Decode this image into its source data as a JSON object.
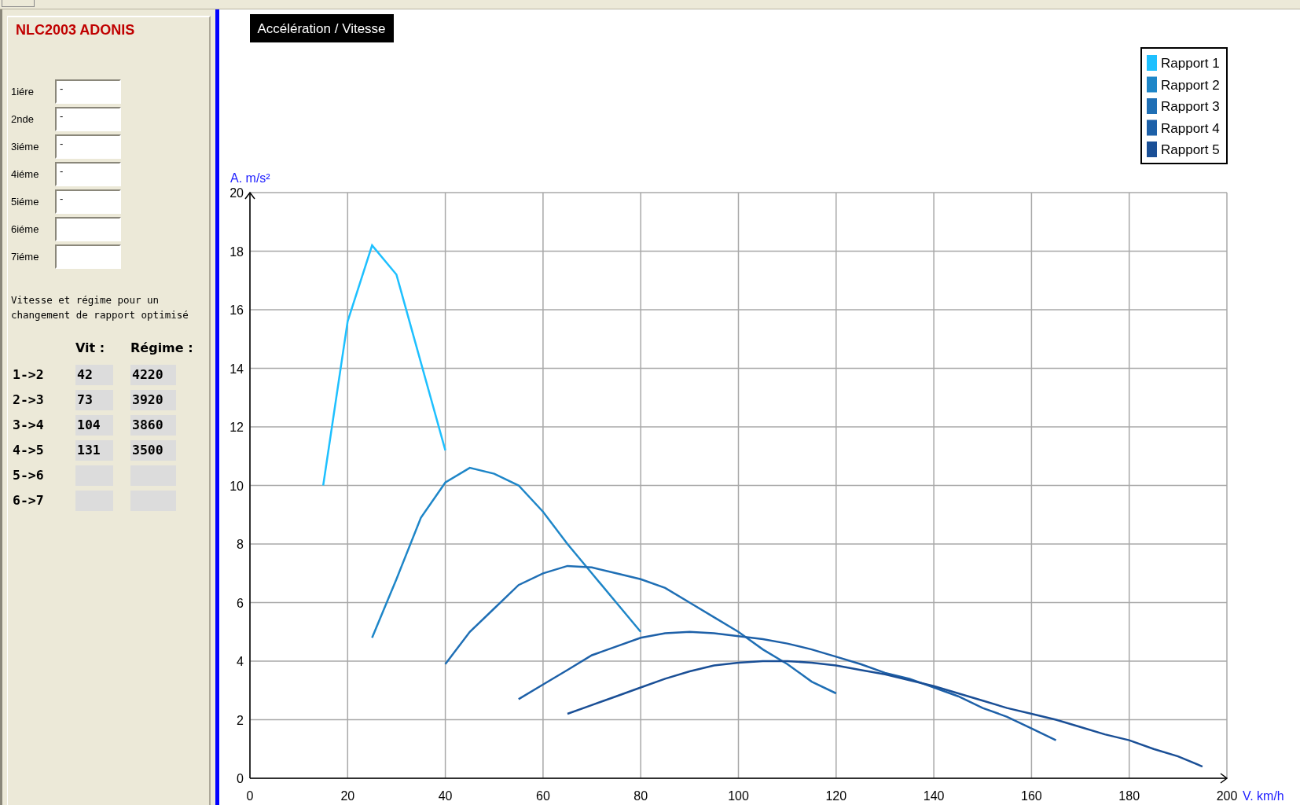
{
  "app": {
    "title": "NLC2003 ADONIS"
  },
  "gears": [
    {
      "label": "1iére",
      "value": "-"
    },
    {
      "label": "2nde",
      "value": "-"
    },
    {
      "label": "3iéme",
      "value": "-"
    },
    {
      "label": "4iéme",
      "value": "-"
    },
    {
      "label": "5iéme",
      "value": "-"
    },
    {
      "label": "6iéme"
    },
    {
      "label": "7iéme"
    }
  ],
  "shift_panel": {
    "caption": "Vitesse et régime pour un changement de rapport optimisé",
    "columns": [
      "Vit :",
      "Régime :"
    ],
    "rows": [
      {
        "label": "1->2",
        "speed": "42",
        "rpm": "4220"
      },
      {
        "label": "2->3",
        "speed": "73",
        "rpm": "3920"
      },
      {
        "label": "3->4",
        "speed": "104",
        "rpm": "3860"
      },
      {
        "label": "4->5",
        "speed": "131",
        "rpm": "3500"
      },
      {
        "label": "5->6"
      },
      {
        "label": "6->7"
      }
    ]
  },
  "chart": {
    "chart_data": {
      "type": "line",
      "grid": true,
      "legend": true,
      "title": "Accélération / Vitesse",
      "xlabel": "V. km/h",
      "ylabel": "A. m/s²",
      "xlim": [
        0,
        200
      ],
      "ylim": [
        0,
        20
      ],
      "xticks": [
        0,
        20,
        40,
        60,
        80,
        100,
        120,
        140,
        160,
        180,
        200
      ],
      "yticks": [
        0,
        2,
        4,
        6,
        8,
        10,
        12,
        14,
        16,
        18,
        20
      ],
      "x": [
        15,
        20,
        25,
        30,
        35,
        40,
        45,
        50,
        55,
        60,
        65,
        70,
        75,
        80,
        85,
        90,
        95,
        100,
        105,
        110,
        115,
        120,
        125,
        130,
        135,
        140,
        145,
        150,
        155,
        160,
        165,
        170,
        175,
        180,
        185,
        190,
        195
      ],
      "series": [
        {
          "name": "Rapport 1",
          "color": "#1ec0ff",
          "values": [
            10,
            15.6,
            18.2,
            17.2,
            14.2,
            11.2,
            null,
            null,
            null,
            null,
            null,
            null,
            null,
            null,
            null,
            null,
            null,
            null,
            null,
            null,
            null,
            null,
            null,
            null,
            null,
            null,
            null,
            null,
            null,
            null,
            null,
            null,
            null,
            null,
            null,
            null,
            null
          ]
        },
        {
          "name": "Rapport 2",
          "color": "#1e86c8",
          "values": [
            null,
            null,
            4.8,
            6.8,
            8.9,
            10.1,
            10.6,
            10.4,
            10,
            9.1,
            8,
            7,
            6,
            5,
            null,
            null,
            null,
            null,
            null,
            null,
            null,
            null,
            null,
            null,
            null,
            null,
            null,
            null,
            null,
            null,
            null,
            null,
            null,
            null,
            null,
            null,
            null
          ]
        },
        {
          "name": "Rapport 3",
          "color": "#1f6fb5",
          "values": [
            null,
            null,
            null,
            null,
            null,
            3.9,
            5,
            5.8,
            6.6,
            7,
            7.25,
            7.2,
            7,
            6.8,
            6.5,
            6,
            5.5,
            5,
            4.4,
            3.9,
            3.3,
            2.9,
            null,
            null,
            null,
            null,
            null,
            null,
            null,
            null,
            null,
            null,
            null,
            null,
            null,
            null,
            null
          ]
        },
        {
          "name": "Rapport 4",
          "color": "#1d60a8",
          "values": [
            null,
            null,
            null,
            null,
            null,
            null,
            null,
            null,
            2.7,
            3.2,
            3.7,
            4.2,
            4.5,
            4.8,
            4.95,
            5,
            4.95,
            4.85,
            4.75,
            4.6,
            4.4,
            4.15,
            3.9,
            3.6,
            3.4,
            3.1,
            2.8,
            2.4,
            2.1,
            1.7,
            1.3,
            null,
            null,
            null,
            null,
            null,
            null
          ]
        },
        {
          "name": "Rapport 5",
          "color": "#1a4f96",
          "values": [
            null,
            null,
            null,
            null,
            null,
            null,
            null,
            null,
            null,
            null,
            2.2,
            2.5,
            2.8,
            3.1,
            3.4,
            3.65,
            3.85,
            3.95,
            4,
            4,
            3.95,
            3.85,
            3.7,
            3.55,
            3.35,
            3.15,
            2.9,
            2.65,
            2.4,
            2.2,
            2,
            1.75,
            1.5,
            1.3,
            1,
            0.75,
            0.4
          ]
        }
      ]
    }
  }
}
